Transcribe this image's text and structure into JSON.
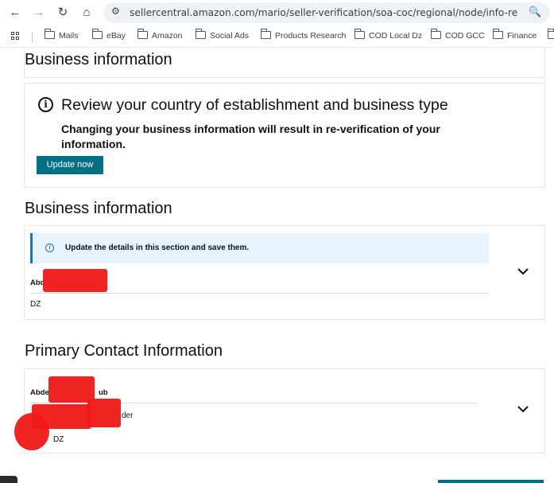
{
  "browser": {
    "url": "sellercentral.amazon.com/mario/seller-verification/soa-coc/regional/node/info-required/ren...",
    "bookmarks": [
      "Mails",
      "eBay",
      "Amazon",
      "Social Ads",
      "Products Research",
      "COD Local Dz",
      "COD GCC",
      "Finance"
    ]
  },
  "header": {
    "title": "Business information"
  },
  "alert": {
    "title": "Review your country of establishment and business type",
    "body": "Changing your business information will result in re-verification of your information.",
    "button": "Update now"
  },
  "business": {
    "title": "Business information",
    "note": "Update the details in this section and save them.",
    "name_partial": "Abd",
    "country": "DZ"
  },
  "contact": {
    "title": "Primary Contact Information",
    "name_partial": "Abde",
    "name_suffix": "ub",
    "role_suffix": "der",
    "country": "DZ"
  }
}
